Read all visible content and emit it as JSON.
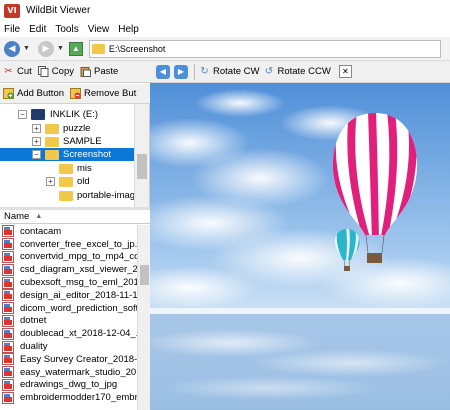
{
  "window": {
    "title": "WildBit Viewer",
    "icon_label": "VI"
  },
  "menu": [
    "File",
    "Edit",
    "Tools",
    "View",
    "Help"
  ],
  "address": {
    "path": "E:\\Screenshot"
  },
  "left_toolbar": {
    "cut": "Cut",
    "copy": "Copy",
    "paste": "Paste",
    "add_button": "Add Button",
    "remove_button": "Remove But"
  },
  "right_toolbar": {
    "rotate_cw": "Rotate CW",
    "rotate_ccw": "Rotate CCW"
  },
  "tree": {
    "drive": "INKLIK (E:)",
    "items": [
      "puzzle",
      "SAMPLE",
      "Screenshot",
      "mis",
      "old",
      "portable-image"
    ]
  },
  "file_list": {
    "header": "Name",
    "files": [
      "contacam",
      "converter_free_excel_to_jp...",
      "convertvid_mpg_to_mp4_co...",
      "csd_diagram_xsd_viewer_2...",
      "cubexsoft_msg_to_eml_201...",
      "design_ai_editor_2018-11-1...",
      "dicom_word_prediction_soft...",
      "dotnet",
      "doublecad_xt_2018-12-04_...",
      "duality",
      "Easy Survey Creator_2018-...",
      "easy_watermark_studio_20...",
      "edrawings_dwg_to_jpg",
      "embroidermodder170_embr..."
    ]
  },
  "colors": {
    "selection": "#0a78d7",
    "accent": "#4a82c7",
    "folder": "#f2c84b"
  }
}
